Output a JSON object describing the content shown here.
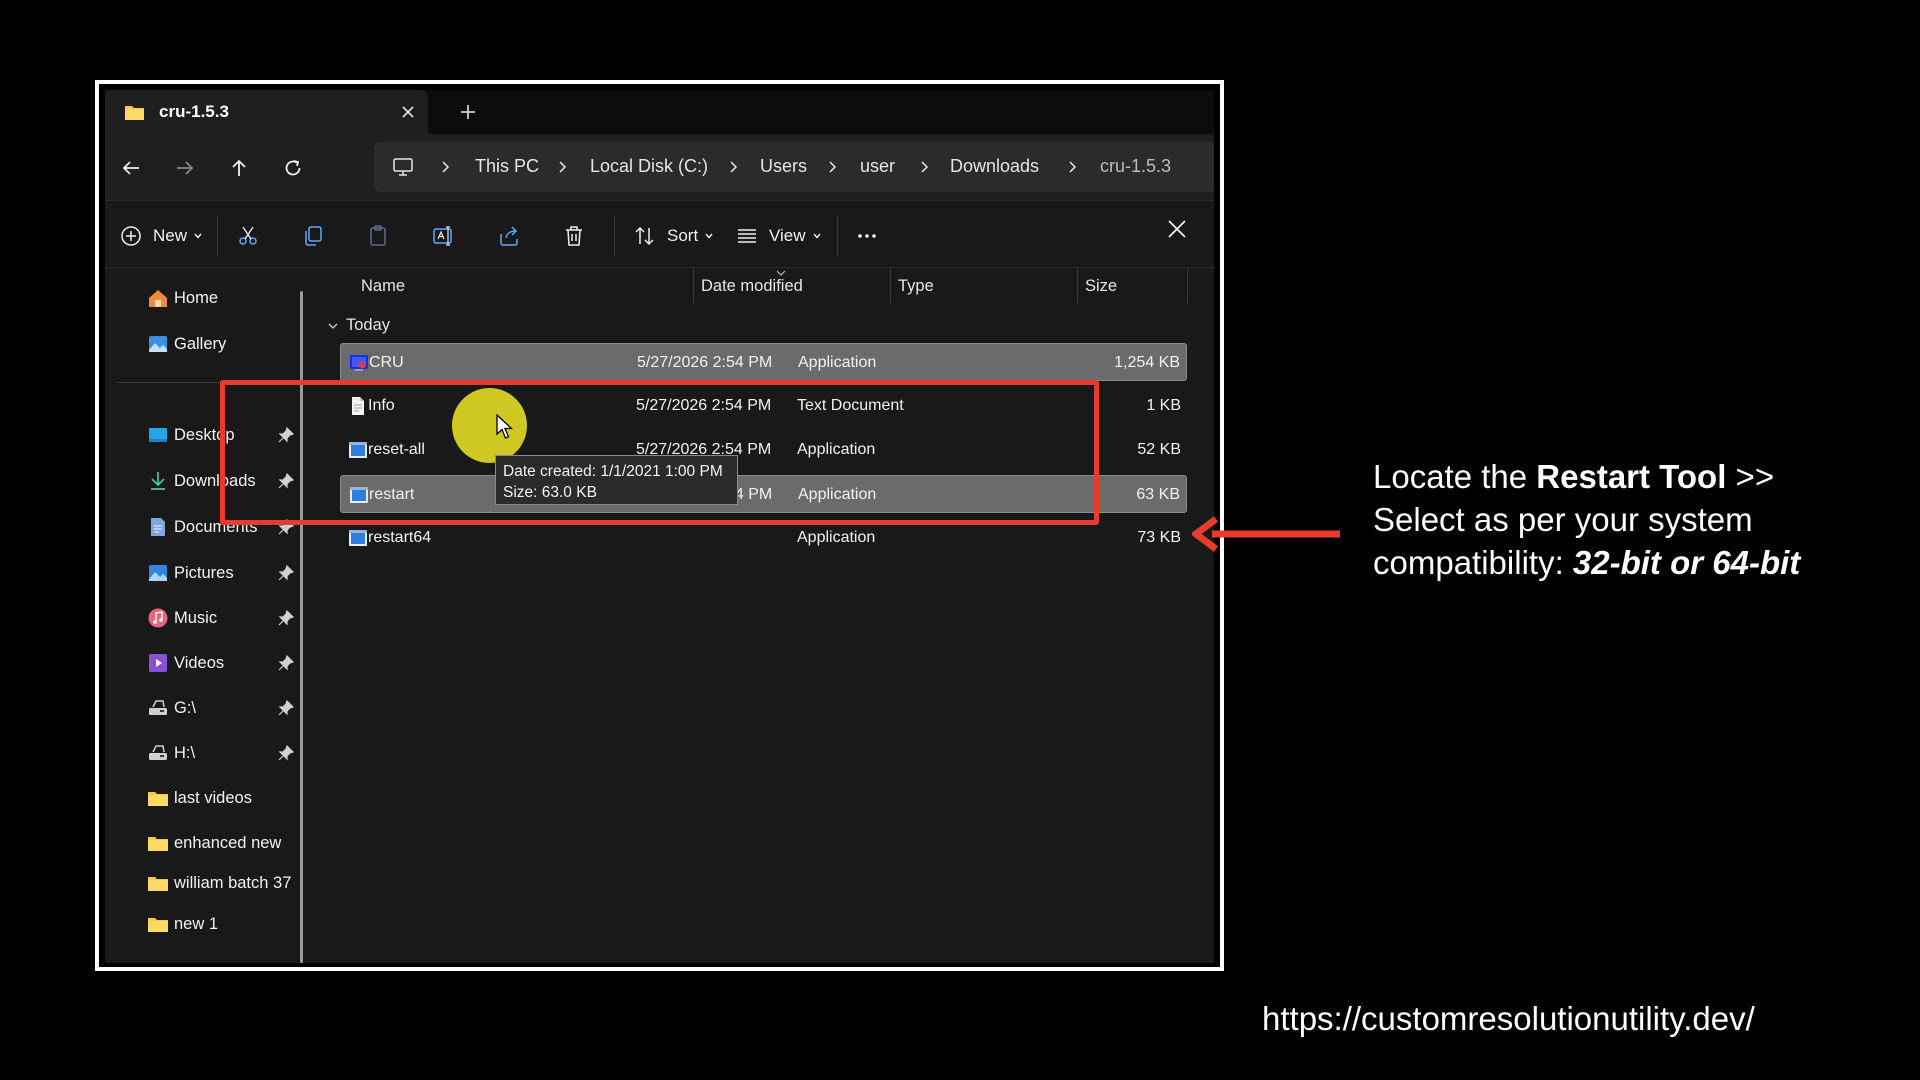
{
  "window": {
    "tab_title": "cru-1.5.3"
  },
  "breadcrumb": {
    "items": [
      "This PC",
      "Local Disk (C:)",
      "Users",
      "user",
      "Downloads",
      "cru-1.5.3"
    ]
  },
  "toolbar": {
    "new_label": "New",
    "sort_label": "Sort",
    "view_label": "View"
  },
  "sidebar": {
    "items": [
      {
        "label": "Home",
        "icon": "home-icon",
        "pinned": false
      },
      {
        "label": "Gallery",
        "icon": "gallery-icon",
        "pinned": false
      },
      {
        "label": "Desktop",
        "icon": "desktop-icon",
        "pinned": true
      },
      {
        "label": "Downloads",
        "icon": "download-icon",
        "pinned": true
      },
      {
        "label": "Documents",
        "icon": "documents-icon",
        "pinned": true
      },
      {
        "label": "Pictures",
        "icon": "pictures-icon",
        "pinned": true
      },
      {
        "label": "Music",
        "icon": "music-icon",
        "pinned": true
      },
      {
        "label": "Videos",
        "icon": "videos-icon",
        "pinned": true
      },
      {
        "label": "G:\\",
        "icon": "drive-icon",
        "pinned": true
      },
      {
        "label": "H:\\",
        "icon": "drive-icon",
        "pinned": true
      },
      {
        "label": "last videos",
        "icon": "folder-icon",
        "pinned": false
      },
      {
        "label": "enhanced new",
        "icon": "folder-icon",
        "pinned": false
      },
      {
        "label": "william batch 37",
        "icon": "folder-icon",
        "pinned": false
      },
      {
        "label": "new 1",
        "icon": "folder-icon",
        "pinned": false
      }
    ]
  },
  "columns": {
    "name": "Name",
    "date_modified": "Date modified",
    "type": "Type",
    "size": "Size"
  },
  "group_label": "Today",
  "files": [
    {
      "name": "CRU",
      "date": "5/27/2026 2:54 PM",
      "type": "Application",
      "size": "1,254 KB",
      "selected": true
    },
    {
      "name": "Info",
      "date": "5/27/2026 2:54 PM",
      "type": "Text Document",
      "size": "1 KB",
      "selected": false
    },
    {
      "name": "reset-all",
      "date": "5/27/2026 2:54 PM",
      "type": "Application",
      "size": "52 KB",
      "selected": false
    },
    {
      "name": "restart",
      "date": "5/27/2026 2:54 PM",
      "type": "Application",
      "size": "63 KB",
      "selected": true
    },
    {
      "name": "restart64",
      "date": "",
      "type": "Application",
      "size": "73 KB",
      "selected": false
    }
  ],
  "tooltip": {
    "line1": "Date created: 1/1/2021 1:00 PM",
    "line2": "Size: 63.0 KB"
  },
  "annotation": {
    "part1": "Locate the ",
    "bold1": "Restart Tool",
    "part2": " >> Select as per your system compatibility: ",
    "bold2": "32-bit or 64-bit",
    "url": "https://customresolutionutility.dev/"
  },
  "colors": {
    "highlight": "#e63b2e",
    "cursor_highlight": "#e8e023",
    "folder": "#f6c94b"
  }
}
